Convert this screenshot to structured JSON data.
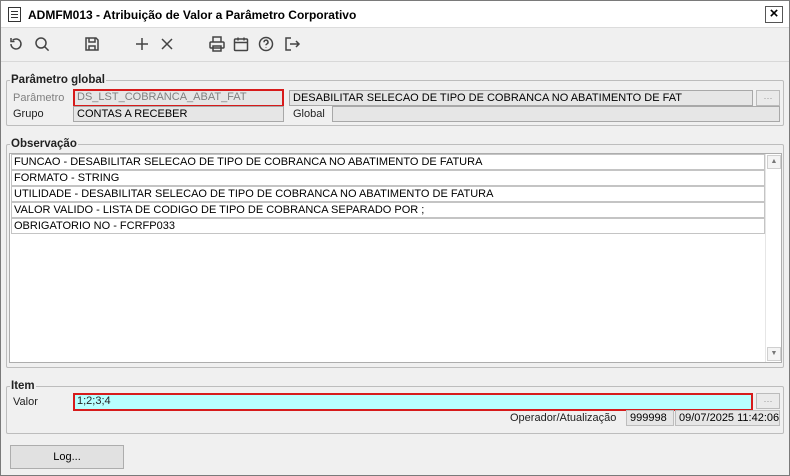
{
  "window": {
    "title": "ADMFM013 - Atribuição de Valor a Parâmetro Corporativo",
    "close_label": "×"
  },
  "toolbar": {
    "items": [
      {
        "icon": "undo-icon"
      },
      {
        "icon": "search-icon"
      },
      {
        "icon": "save-icon"
      },
      {
        "icon": "add-icon"
      },
      {
        "icon": "delete-icon"
      },
      {
        "icon": "print-icon"
      },
      {
        "icon": "calendar-icon"
      },
      {
        "icon": "help-icon"
      },
      {
        "icon": "exit-icon"
      }
    ]
  },
  "parametro_global": {
    "legend": "Parâmetro global",
    "parametro_label": "Parâmetro",
    "parametro_value": "DS_LST_COBRANCA_ABAT_FAT",
    "descricao_value": "DESABILITAR SELECAO DE TIPO DE COBRANCA NO ABATIMENTO DE FAT",
    "grupo_label": "Grupo",
    "grupo_value": "CONTAS A RECEBER",
    "global_label": "Global",
    "global_value": ""
  },
  "observacao": {
    "legend": "Observação",
    "lines": [
      "FUNCAO - DESABILITAR SELECAO DE TIPO DE COBRANCA NO ABATIMENTO DE FATURA",
      "FORMATO - STRING",
      "UTILIDADE - DESABILITAR SELECAO DE TIPO DE COBRANCA NO ABATIMENTO DE FATURA",
      "VALOR VALIDO - LISTA DE CODIGO DE TIPO DE COBRANCA SEPARADO POR ;",
      "OBRIGATORIO NO - FCRFP033"
    ]
  },
  "item": {
    "legend": "Item",
    "valor_label": "Valor",
    "valor_value": "1;2;3;4",
    "operador_label": "Operador/Atualização",
    "operador_value": "999998",
    "atualizacao_value": "09/07/2025 11:42:06"
  },
  "footer": {
    "log_label": "Log..."
  },
  "colors": {
    "highlight_border": "#d71b1b",
    "valor_background": "#b8ffff"
  }
}
